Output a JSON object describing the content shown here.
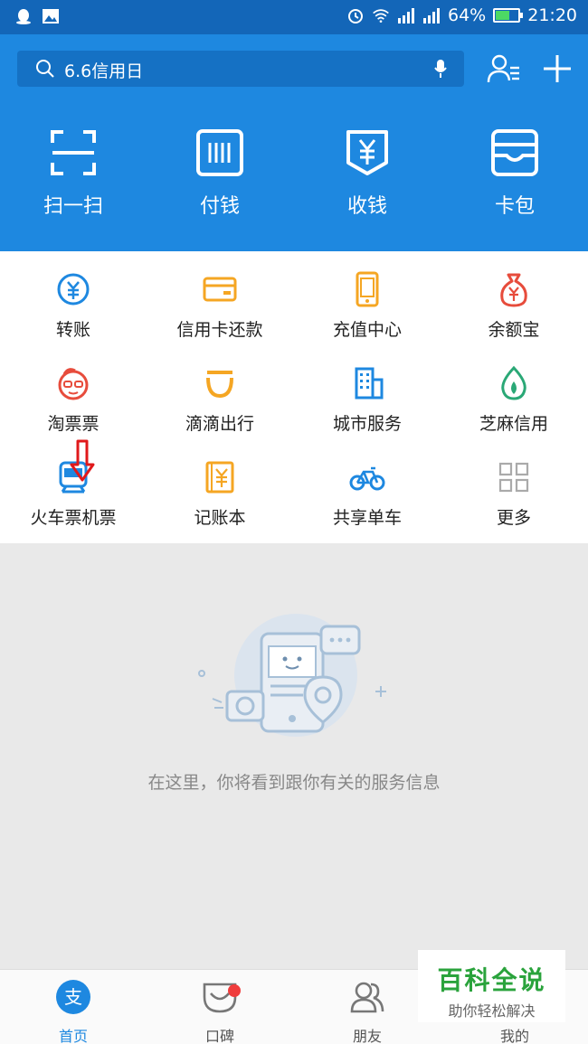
{
  "status": {
    "battery": "64%",
    "time": "21:20",
    "battery_level": 0.64
  },
  "search": {
    "placeholder": "6.6信用日"
  },
  "quick_actions": [
    {
      "label": "扫一扫",
      "icon": "scan-icon"
    },
    {
      "label": "付钱",
      "icon": "barcode-icon"
    },
    {
      "label": "收钱",
      "icon": "receive-money-icon"
    },
    {
      "label": "卡包",
      "icon": "card-wallet-icon"
    }
  ],
  "services": [
    {
      "label": "转账",
      "icon": "transfer-icon",
      "color": "#1e88e0"
    },
    {
      "label": "信用卡还款",
      "icon": "credit-card-icon",
      "color": "#f5a623"
    },
    {
      "label": "充值中心",
      "icon": "phone-recharge-icon",
      "color": "#f5a623"
    },
    {
      "label": "余额宝",
      "icon": "money-bag-icon",
      "color": "#e74c3c"
    },
    {
      "label": "淘票票",
      "icon": "taopiaopiao-icon",
      "color": "#e74c3c"
    },
    {
      "label": "滴滴出行",
      "icon": "didi-icon",
      "color": "#f5a623"
    },
    {
      "label": "城市服务",
      "icon": "city-building-icon",
      "color": "#1e88e0"
    },
    {
      "label": "芝麻信用",
      "icon": "sesame-credit-icon",
      "color": "#2aa876"
    },
    {
      "label": "火车票机票",
      "icon": "train-icon",
      "color": "#1e88e0"
    },
    {
      "label": "记账本",
      "icon": "account-book-icon",
      "color": "#f5a623"
    },
    {
      "label": "共享单车",
      "icon": "bicycle-icon",
      "color": "#1e88e0"
    },
    {
      "label": "更多",
      "icon": "more-grid-icon",
      "color": "#999999"
    }
  ],
  "empty_message": "在这里，你将看到跟你有关的服务信息",
  "tabs": [
    {
      "label": "首页",
      "icon": "alipay-home-icon",
      "active": true
    },
    {
      "label": "口碑",
      "icon": "koubei-icon",
      "active": false
    },
    {
      "label": "朋友",
      "icon": "friends-icon",
      "active": false
    },
    {
      "label": "我的",
      "icon": "me-icon",
      "active": false
    }
  ],
  "watermark": {
    "title": "百科全说",
    "subtitle": "助你轻松解决"
  },
  "colors": {
    "brand_blue": "#1e88e0",
    "status_bar": "#1366b8",
    "annotation_red": "#e0191b"
  }
}
